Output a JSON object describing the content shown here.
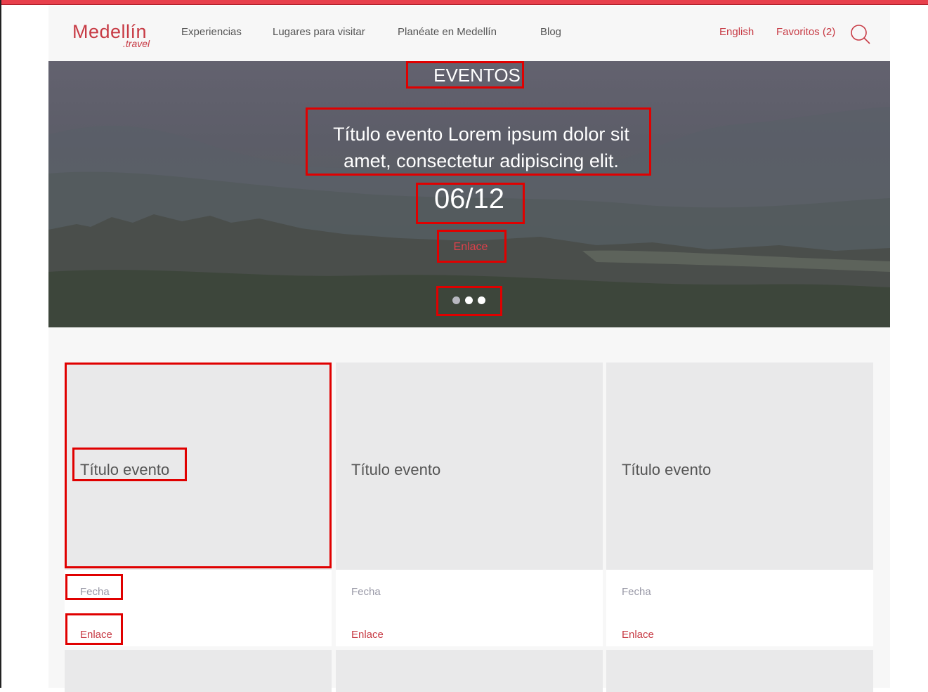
{
  "header": {
    "logo": {
      "main": "Medellín",
      "sub": ".travel"
    },
    "nav": [
      "Experiencias",
      "Lugares para visitar",
      "Planéate en Medellín",
      "Blog"
    ],
    "language": "English",
    "favorites": "Favoritos (2)"
  },
  "hero": {
    "label": "EVENTOS",
    "title_line1": "Título evento Lorem ipsum dolor sit",
    "title_line2": "amet, consectetur adipiscing elit.",
    "date": "06/12",
    "link": "Enlace"
  },
  "cards": [
    {
      "title": "Título evento",
      "date": "Fecha",
      "link": "Enlace"
    },
    {
      "title": "Título evento",
      "date": "Fecha",
      "link": "Enlace"
    },
    {
      "title": "Título evento",
      "date": "Fecha",
      "link": "Enlace"
    }
  ],
  "colors": {
    "accent": "#c73a44",
    "highlight": "#e00000",
    "card_bg": "#e9e9ea"
  }
}
